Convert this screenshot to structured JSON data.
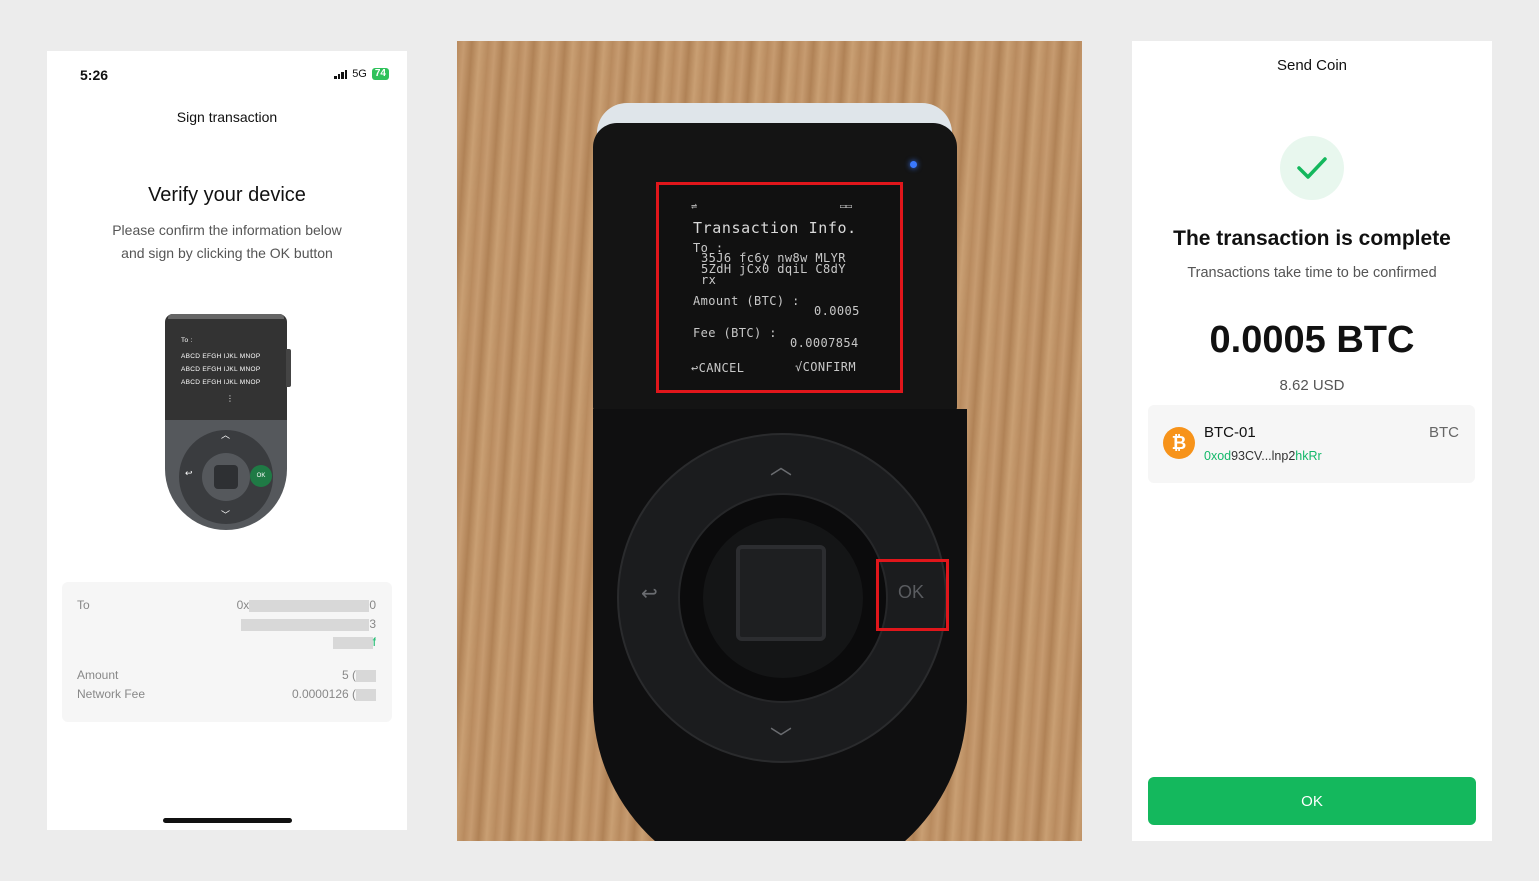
{
  "phone": {
    "status_time": "5:26",
    "network": "5G",
    "battery": "74",
    "title": "Sign transaction",
    "heading": "Verify your device",
    "description_line1": "Please confirm the information below",
    "description_line2": "and sign by clicking the OK button",
    "mini_device": {
      "to_label": "To :",
      "lines": [
        "ABCD EFGH IJKL MNOP",
        "ABCD EFGH IJKL MNOP",
        "ABCD EFGH IJKL MNOP"
      ],
      "dots": "⋮",
      "ok_label": "OK"
    },
    "details": {
      "to_label": "To",
      "to_line1_start": "0x",
      "to_line1_end": "0",
      "to_line2_end": "3",
      "to_line3_end": "f",
      "amount_label": "Amount",
      "amount_value": "5 (",
      "fee_label": "Network Fee",
      "fee_value": "0.0000126 ("
    }
  },
  "device_screen": {
    "title": "Transaction Info.",
    "to_label": "To :",
    "address_line1": "35J6 fc6y nw8w MLYR",
    "address_line2": "5ZdH jCx0 dqiL C8dY",
    "address_line3": "rx",
    "amount_label": "Amount (BTC) :",
    "amount_value": "0.0005",
    "fee_label": "Fee (BTC) :",
    "fee_value": "0.0007854",
    "cancel_label": "↩CANCEL",
    "confirm_label": "√CONFIRM",
    "ok_label": "OK"
  },
  "app": {
    "title": "Send Coin",
    "heading": "The transaction is complete",
    "subheading": "Transactions take time to be confirmed",
    "amount": "0.0005 BTC",
    "fiat": "8.62 USD",
    "coin": {
      "name": "BTC-01",
      "symbol": "BTC",
      "addr_prefix": "0xod",
      "addr_middle": "93CV...lnp2",
      "addr_suffix": "hkRr",
      "icon": "₿"
    },
    "ok_button": "OK"
  },
  "colors": {
    "accent_green": "#14b85d",
    "highlight_red": "#e0161b",
    "bitcoin_orange": "#f7931a"
  }
}
